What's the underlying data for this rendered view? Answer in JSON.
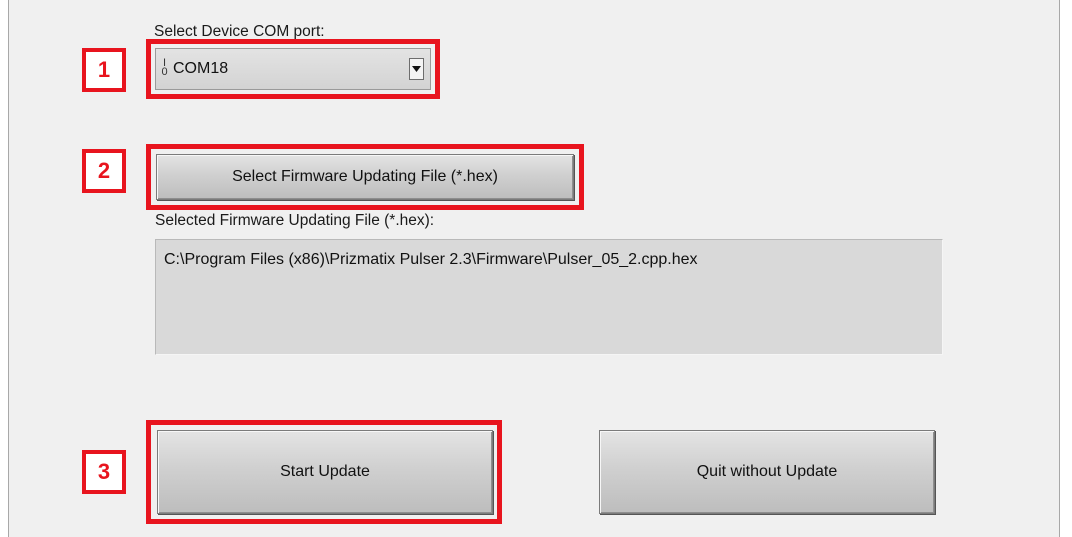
{
  "com_port": {
    "label": "Select Device COM port:",
    "value": "COM18",
    "icon": "io-icon"
  },
  "steps": [
    "1",
    "2",
    "3"
  ],
  "firmware": {
    "select_button": "Select Firmware Updating File (*.hex)",
    "selected_label": "Selected Firmware Updating File (*.hex):",
    "selected_path": "C:\\Program Files (x86)\\Prizmatix Pulser 2.3\\Firmware\\Pulser_05_2.cpp.hex"
  },
  "actions": {
    "start": "Start Update",
    "quit": "Quit without Update"
  },
  "colors": {
    "highlight": "#e8141e",
    "panel": "#f0f0f0"
  }
}
